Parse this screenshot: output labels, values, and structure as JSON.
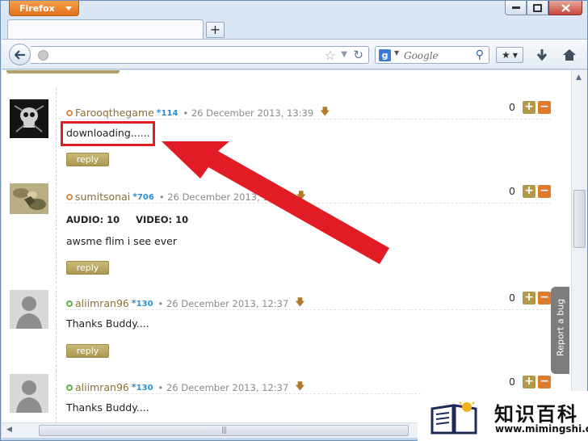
{
  "browser": {
    "menu_button_label": "Firefox",
    "new_tab_glyph": "+",
    "search_placeholder": "Google",
    "search_engine_glyph": "g"
  },
  "comments": [
    {
      "username": "Farooqthegame",
      "rep": "114",
      "date": "• 26 December 2013, 13:39",
      "body": "downloading......",
      "reply_label": "reply",
      "score": "0",
      "avatar": "dark-skull-avatar",
      "status": "away"
    },
    {
      "username": "sumitsonai",
      "rep": "706",
      "date": "• 26 December 2013, 13:41",
      "audio_video": "AUDIO: 10     VIDEO: 10",
      "body": "awsme flim i see ever",
      "reply_label": "reply",
      "score": "0",
      "avatar": "camouflage-avatar",
      "status": "away"
    },
    {
      "username": "aliimran96",
      "rep": "130",
      "date": "• 26 December 2013, 12:37",
      "body": "Thanks Buddy....",
      "reply_label": "reply",
      "score": "0",
      "avatar": "default-person-avatar",
      "status": "online"
    },
    {
      "username": "aliimran96",
      "rep": "130",
      "date": "• 26 December 2013, 12:37",
      "body": "Thanks Buddy....",
      "score": "0",
      "avatar": "default-person-avatar",
      "status": "online"
    }
  ],
  "vote": {
    "plus": "+",
    "minus": "−"
  },
  "report_bug_label": "Report a bug",
  "watermark": {
    "chinese": "知识百科",
    "url": "www.mimingshi.com"
  },
  "colors": {
    "highlight": "#e11c24",
    "arrow": "#e11c24",
    "reply_button": "#b4a25e",
    "minus_button": "#dd7a2c"
  }
}
